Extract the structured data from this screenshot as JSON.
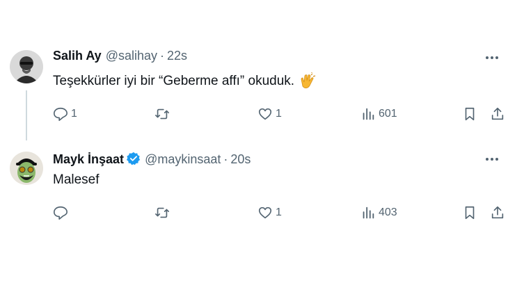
{
  "tweets": [
    {
      "name": "Salih Ay",
      "handle": "@salihay",
      "dot": "·",
      "time": "22s",
      "text": "Teşekkürler iyi bir “Geberme affı” okuduk.",
      "emoji_icon": "clapping-hands-icon",
      "replies": "1",
      "retweets": "",
      "likes": "1",
      "views": "601"
    },
    {
      "name": "Mayk İnşaat",
      "verified": true,
      "handle": "@maykinsaat",
      "dot": "·",
      "time": "20s",
      "text": "Malesef",
      "replies": "",
      "retweets": "",
      "likes": "1",
      "views": "403"
    }
  ],
  "colors": {
    "text": "#0f1419",
    "secondary": "#536471",
    "verified": "#1d9bf0",
    "thread_line": "#cfd9de"
  }
}
